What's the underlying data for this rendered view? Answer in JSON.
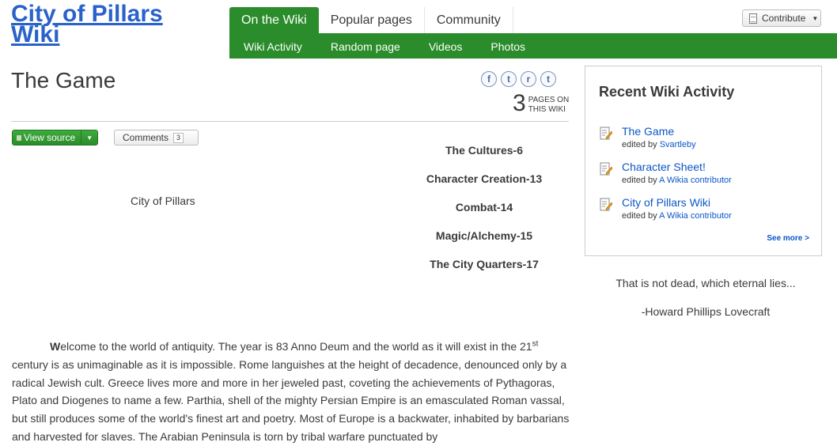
{
  "header": {
    "wiki_title": "City of Pillars Wiki",
    "tabs": [
      {
        "label": "On the Wiki",
        "active": true
      },
      {
        "label": "Popular pages",
        "active": false
      },
      {
        "label": "Community",
        "active": false
      }
    ],
    "subnav": [
      "Wiki Activity",
      "Random page",
      "Videos",
      "Photos"
    ],
    "contribute_label": "Contribute"
  },
  "page": {
    "title": "The Game",
    "share_icons": [
      {
        "name": "facebook-icon",
        "glyph": "f"
      },
      {
        "name": "twitter-icon",
        "glyph": "t"
      },
      {
        "name": "reddit-icon",
        "glyph": "r"
      },
      {
        "name": "tumblr-icon",
        "glyph": "t"
      }
    ],
    "page_count": "3",
    "page_count_label": "PAGES ON THIS WIKI",
    "view_source_label": "View source",
    "comments_label": "Comments",
    "comments_count": "3"
  },
  "article": {
    "city_label": "City of Pillars",
    "toc": [
      "The Cultures-6",
      "Character Creation-13",
      "Combat-14",
      "Magic/Alchemy-15",
      "The City Quarters-17"
    ],
    "intro_first_letter": "W",
    "intro_part1": "elcome to the world of antiquity. The year is 83 Anno Deum and the world as it will exist in the 21",
    "intro_sup": "st",
    "intro_part2": " century is as unimaginable as it is impossible. Rome languishes at the height of decadence, denounced only by a radical Jewish cult. Greece lives more and more in her jeweled past, coveting the achievements of Pythagoras, Plato and Diogenes to name a few. Parthia, shell of the mighty Persian Empire is an emasculated Roman vassal, but still produces some of the world's finest art and poetry. Most of Europe is a backwater, inhabited by barbarians and harvested for slaves. The Arabian Peninsula is torn by tribal warfare punctuated by"
  },
  "rail": {
    "activity_title": "Recent Wiki Activity",
    "edited_by": "edited by",
    "items": [
      {
        "title": "The Game",
        "user": "Svartleby"
      },
      {
        "title": "Character Sheet!",
        "user": "A Wikia contributor"
      },
      {
        "title": "City of Pillars Wiki",
        "user": "A Wikia contributor"
      }
    ],
    "see_more": "See more >",
    "quote_line1": "That is not dead, which eternal lies...",
    "quote_line2": "-Howard Phillips Lovecraft"
  },
  "colors": {
    "accent_green": "#2a8c2a",
    "link_blue": "#0b56c7",
    "title_blue": "#2a62c9"
  }
}
